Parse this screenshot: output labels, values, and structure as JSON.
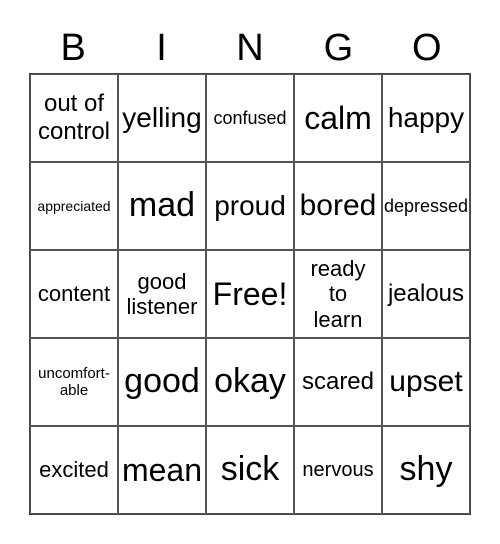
{
  "header": {
    "letters": [
      "B",
      "I",
      "N",
      "G",
      "O"
    ]
  },
  "cells": [
    "out of control",
    "yelling",
    "confused",
    "calm",
    "happy",
    "appreciated",
    "mad",
    "proud",
    "bored",
    "depressed",
    "content",
    "good listener",
    "Free!",
    "ready to learn",
    "jealous",
    "uncomfort-able",
    "good",
    "okay",
    "scared",
    "upset",
    "excited",
    "mean",
    "sick",
    "nervous",
    "shy"
  ]
}
